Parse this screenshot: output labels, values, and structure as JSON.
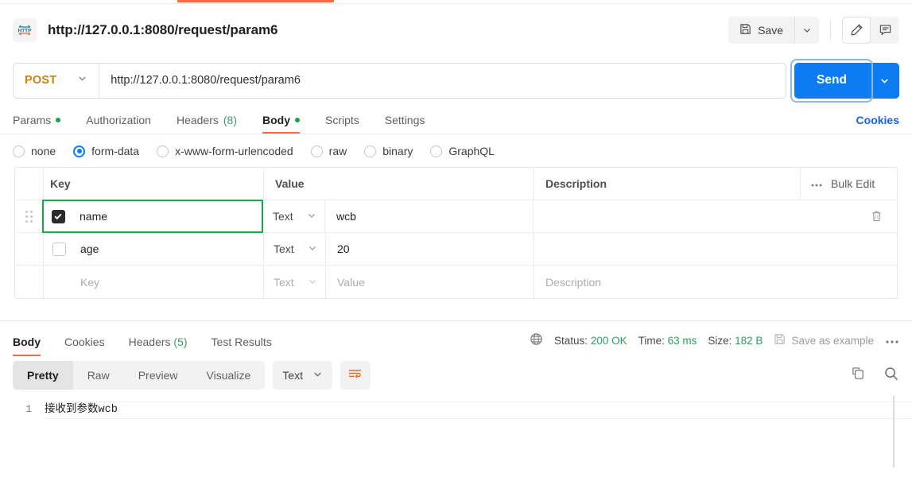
{
  "window": {
    "tab_indicator_color": "#ff6c37",
    "title": "http://127.0.0.1:8080/request/param6",
    "protocol_icon": "HTTP",
    "save_label": "Save",
    "save_caret_icon": "chevron-down-icon",
    "edit_icon": "pencil-icon",
    "comment_icon": "comment-icon"
  },
  "request": {
    "method": "POST",
    "method_caret_icon": "chevron-down-icon",
    "url": "http://127.0.0.1:8080/request/param6",
    "send_label": "Send",
    "send_caret_icon": "chevron-down-icon",
    "accent_blue": "#0d7cf2",
    "tabs": [
      {
        "label": "Params",
        "dot": true,
        "active": false
      },
      {
        "label": "Authorization",
        "dot": false,
        "active": false
      },
      {
        "label": "Headers",
        "count": "(8)",
        "dot": false,
        "active": false
      },
      {
        "label": "Body",
        "dot": true,
        "active": true
      },
      {
        "label": "Scripts",
        "dot": false,
        "active": false
      },
      {
        "label": "Settings",
        "dot": false,
        "active": false
      }
    ],
    "cookies_link": "Cookies",
    "body_types": [
      {
        "label": "none",
        "selected": false
      },
      {
        "label": "form-data",
        "selected": true
      },
      {
        "label": "x-www-form-urlencoded",
        "selected": false
      },
      {
        "label": "raw",
        "selected": false
      },
      {
        "label": "binary",
        "selected": false
      },
      {
        "label": "GraphQL",
        "selected": false
      }
    ]
  },
  "params_table": {
    "headers": {
      "key": "Key",
      "value": "Value",
      "description": "Description",
      "more_icon": "ellipsis-icon",
      "bulk_edit": "Bulk Edit"
    },
    "rows": [
      {
        "checked": true,
        "focused": true,
        "key": "name",
        "type": "Text",
        "value": "wcb",
        "description": "",
        "delete_icon": "trash-icon"
      },
      {
        "checked": false,
        "focused": false,
        "key": "age",
        "type": "Text",
        "value": "20",
        "description": ""
      }
    ],
    "empty_row": {
      "key_placeholder": "Key",
      "type_placeholder": "Text",
      "value_placeholder": "Value",
      "description_placeholder": "Description"
    }
  },
  "response": {
    "tabs": [
      {
        "label": "Body",
        "active": true
      },
      {
        "label": "Cookies",
        "active": false
      },
      {
        "label": "Headers",
        "count": "(5)",
        "active": false
      },
      {
        "label": "Test Results",
        "active": false
      }
    ],
    "globe_icon": "globe-icon",
    "status_label": "Status:",
    "status_value": "200 OK",
    "time_label": "Time:",
    "time_value": "63 ms",
    "size_label": "Size:",
    "size_value": "182 B",
    "save_example_icon": "save-icon",
    "save_example_label": "Save as example",
    "more_icon": "ellipsis-icon",
    "status_green": "#2f9e5f",
    "view_modes": [
      {
        "label": "Pretty",
        "active": true
      },
      {
        "label": "Raw",
        "active": false
      },
      {
        "label": "Preview",
        "active": false
      },
      {
        "label": "Visualize",
        "active": false
      }
    ],
    "format": "Text",
    "format_caret_icon": "chevron-down-icon",
    "wrap_icon": "word-wrap-icon",
    "copy_icon": "copy-icon",
    "search_icon": "search-icon",
    "body_lines": [
      {
        "number": "1",
        "text": "接收到参数wcb"
      }
    ]
  }
}
